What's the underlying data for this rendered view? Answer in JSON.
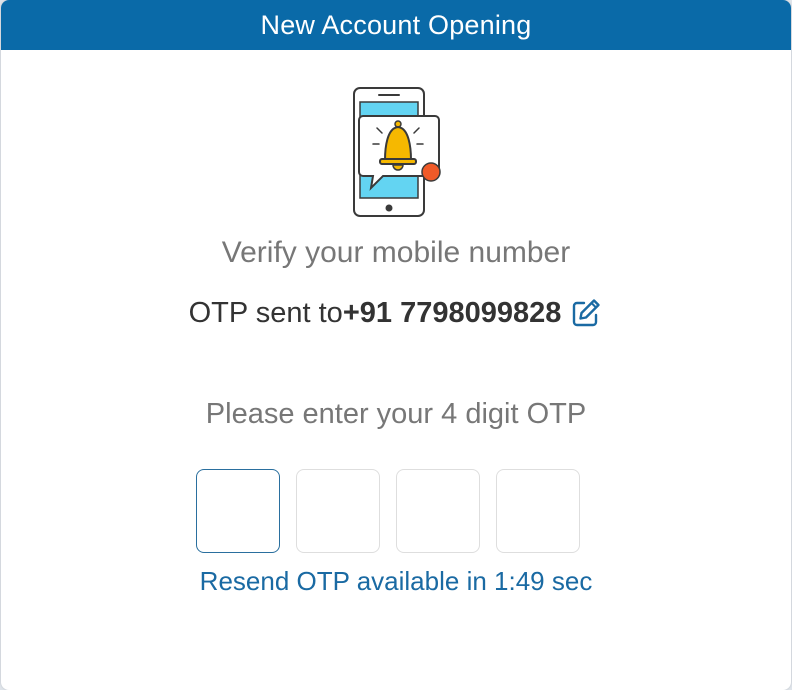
{
  "header": {
    "title": "New Account Opening"
  },
  "verify": {
    "title": "Verify your mobile number",
    "otp_sent_prefix": "OTP sent to",
    "phone_number": "+91 7798099828"
  },
  "otp": {
    "prompt": "Please enter your 4 digit OTP",
    "digits": [
      "",
      "",
      "",
      ""
    ],
    "resend_text": "Resend OTP available in 1:49 sec"
  },
  "icons": {
    "illustration": "phone-notification-bell-icon",
    "edit": "edit-pencil-icon"
  },
  "colors": {
    "header_bg": "#0a6aa8",
    "accent": "#1a6aa3",
    "bell": "#f6b800",
    "notification_dot": "#f05a28",
    "phone_screen": "#63d4f2"
  }
}
